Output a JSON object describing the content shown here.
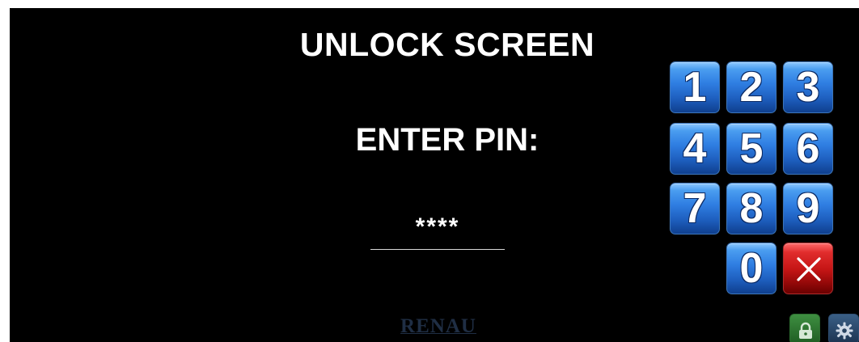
{
  "screen": {
    "title": "UNLOCK SCREEN",
    "prompt": "ENTER PIN:",
    "pin_value": "****"
  },
  "keypad": {
    "keys": [
      {
        "label": "1"
      },
      {
        "label": "2"
      },
      {
        "label": "3"
      },
      {
        "label": "4"
      },
      {
        "label": "5"
      },
      {
        "label": "6"
      },
      {
        "label": "7"
      },
      {
        "label": "8"
      },
      {
        "label": "9"
      },
      {
        "label": "0"
      }
    ],
    "clear_icon": "close-icon"
  },
  "footer": {
    "brand": "RENAU",
    "icons": [
      "lock-icon",
      "gear-icon"
    ]
  },
  "colors": {
    "background": "#000000",
    "key_blue": "#2f7ee2",
    "key_red": "#c51515",
    "lock_green": "#3e8f41",
    "settings_blue": "#3a5f86"
  }
}
